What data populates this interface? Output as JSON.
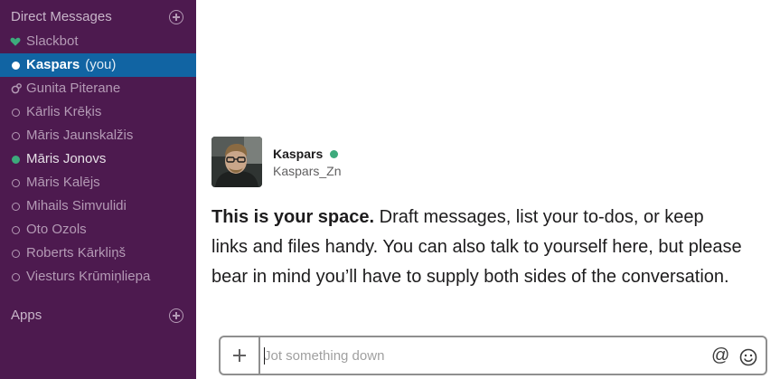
{
  "sidebar": {
    "direct_messages_header": "Direct Messages",
    "apps_header": "Apps",
    "items": [
      {
        "label": "Slackbot",
        "presence": "heart"
      },
      {
        "label": "Kaspars",
        "suffix": "(you)",
        "presence": "self",
        "active": true
      },
      {
        "label": "Gunita Piterane",
        "presence": "group"
      },
      {
        "label": "Kārlis Krēķis",
        "presence": "away"
      },
      {
        "label": "Māris Jaunskalžis",
        "presence": "away"
      },
      {
        "label": "Māris Jonovs",
        "presence": "online"
      },
      {
        "label": "Māris Kalējs",
        "presence": "away"
      },
      {
        "label": "Mihails Simvulidi",
        "presence": "away"
      },
      {
        "label": "Oto Ozols",
        "presence": "away"
      },
      {
        "label": "Roberts Kārkliņš",
        "presence": "away"
      },
      {
        "label": "Viesturs Krūmiņliepa",
        "presence": "away"
      }
    ],
    "colors": {
      "background": "#4d1a4f",
      "active": "#1164a3",
      "online": "#3daa7c"
    }
  },
  "profile": {
    "name": "Kaspars",
    "username": "Kaspars_Zn"
  },
  "intro": {
    "bold": "This is your space.",
    "text": "Draft messages, list your to-dos, or keep links and files handy. You can also talk to yourself here, but please bear in mind you’ll have to supply both sides of the conversation."
  },
  "composer": {
    "placeholder": "Jot something down",
    "value": "",
    "mention_symbol": "@",
    "icons": [
      "plus-icon",
      "at-icon",
      "emoji-icon"
    ]
  }
}
